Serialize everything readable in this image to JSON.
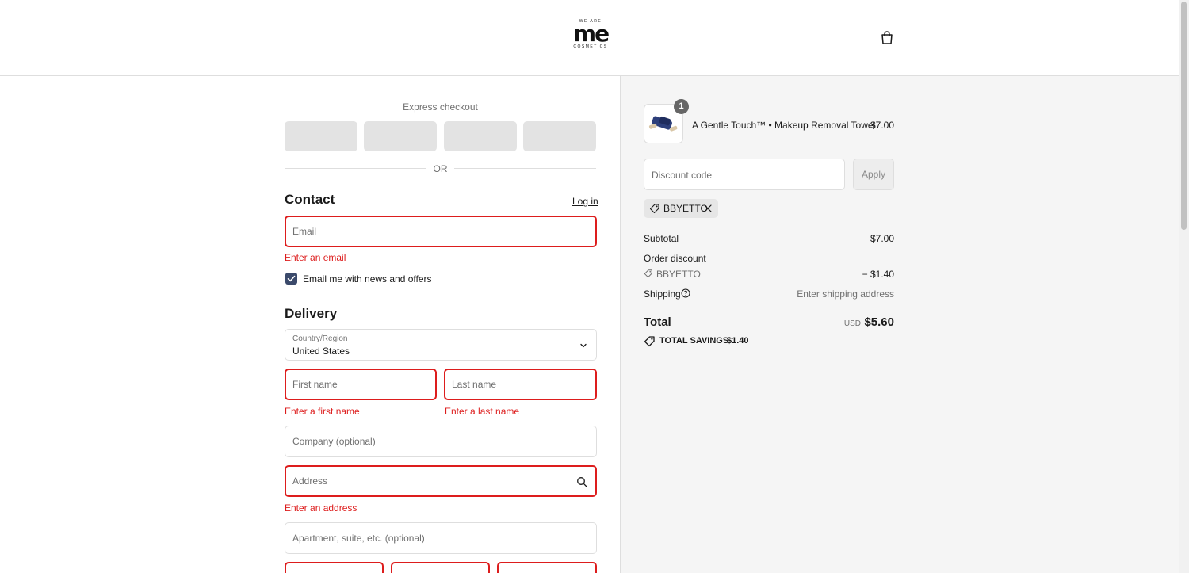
{
  "header": {
    "logo_top": "WE ARE",
    "logo_main": "me",
    "logo_bottom": "COSMETICS"
  },
  "express": {
    "title": "Express checkout",
    "buttons": [
      "",
      "",
      "",
      ""
    ],
    "or_label": "OR"
  },
  "contact": {
    "heading": "Contact",
    "login_label": "Log in",
    "email_placeholder": "Email",
    "email_error": "Enter an email",
    "newsletter_label": "Email me with news and offers",
    "newsletter_checked": true
  },
  "delivery": {
    "heading": "Delivery",
    "country_label": "Country/Region",
    "country_value": "United States",
    "first_name_placeholder": "First name",
    "first_name_error": "Enter a first name",
    "last_name_placeholder": "Last name",
    "last_name_error": "Enter a last name",
    "company_placeholder": "Company (optional)",
    "address_placeholder": "Address",
    "address_error": "Enter an address",
    "apartment_placeholder": "Apartment, suite, etc. (optional)"
  },
  "summary": {
    "product": {
      "quantity": "1",
      "name": "A Gentle Touch™ • Makeup Removal Towel",
      "price": "$7.00"
    },
    "discount_placeholder": "Discount code",
    "apply_label": "Apply",
    "applied_code": "BBYETTO",
    "subtotal_label": "Subtotal",
    "subtotal_value": "$7.00",
    "order_discount_label": "Order discount",
    "discount_code": "BBYETTO",
    "discount_value": "− $1.40",
    "shipping_label": "Shipping",
    "shipping_value": "Enter shipping address",
    "total_label": "Total",
    "currency": "USD",
    "total_value": "$5.60",
    "savings_label": "TOTAL SAVINGS",
    "savings_value": "$1.40"
  },
  "colors": {
    "error": "#dd1d1d",
    "checkbox": "#3b4a6b",
    "summary_bg": "#f5f5f5"
  }
}
